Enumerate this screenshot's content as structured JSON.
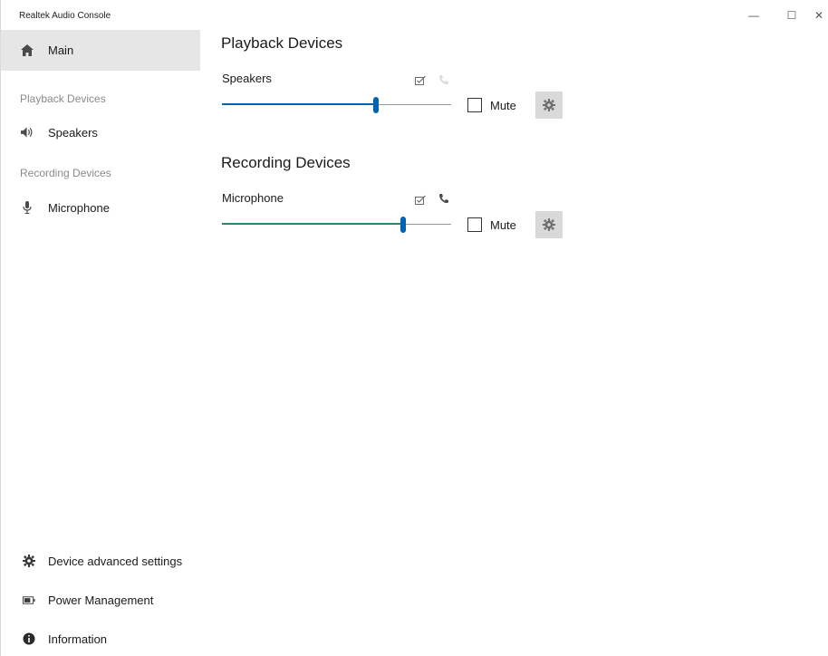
{
  "window": {
    "title": "Realtek Audio Console",
    "controls": {
      "minimize": "—",
      "maximize": "☐",
      "close": "✕"
    }
  },
  "sidebar": {
    "main": {
      "label": "Main",
      "icon": "home-icon"
    },
    "playback_section": "Playback Devices",
    "speakers": {
      "label": "Speakers",
      "icon": "speaker-icon"
    },
    "recording_section": "Recording Devices",
    "microphone": {
      "label": "Microphone",
      "icon": "microphone-icon"
    },
    "bottom": {
      "advanced": {
        "label": "Device advanced settings",
        "icon": "gear-icon"
      },
      "power": {
        "label": "Power Management",
        "icon": "battery-icon"
      },
      "info": {
        "label": "Information",
        "icon": "info-icon"
      }
    }
  },
  "playback": {
    "title": "Playback Devices",
    "device": "Speakers",
    "volume": 0.67,
    "mute_label": "Mute",
    "muted": false
  },
  "recording": {
    "title": "Recording Devices",
    "device": "Microphone",
    "volume": 0.79,
    "mute_label": "Mute",
    "muted": false
  },
  "colors": {
    "accent": "#0063b1",
    "slider_fill_recording": "#1f8a70",
    "selected_bg": "#e6e6e6"
  }
}
